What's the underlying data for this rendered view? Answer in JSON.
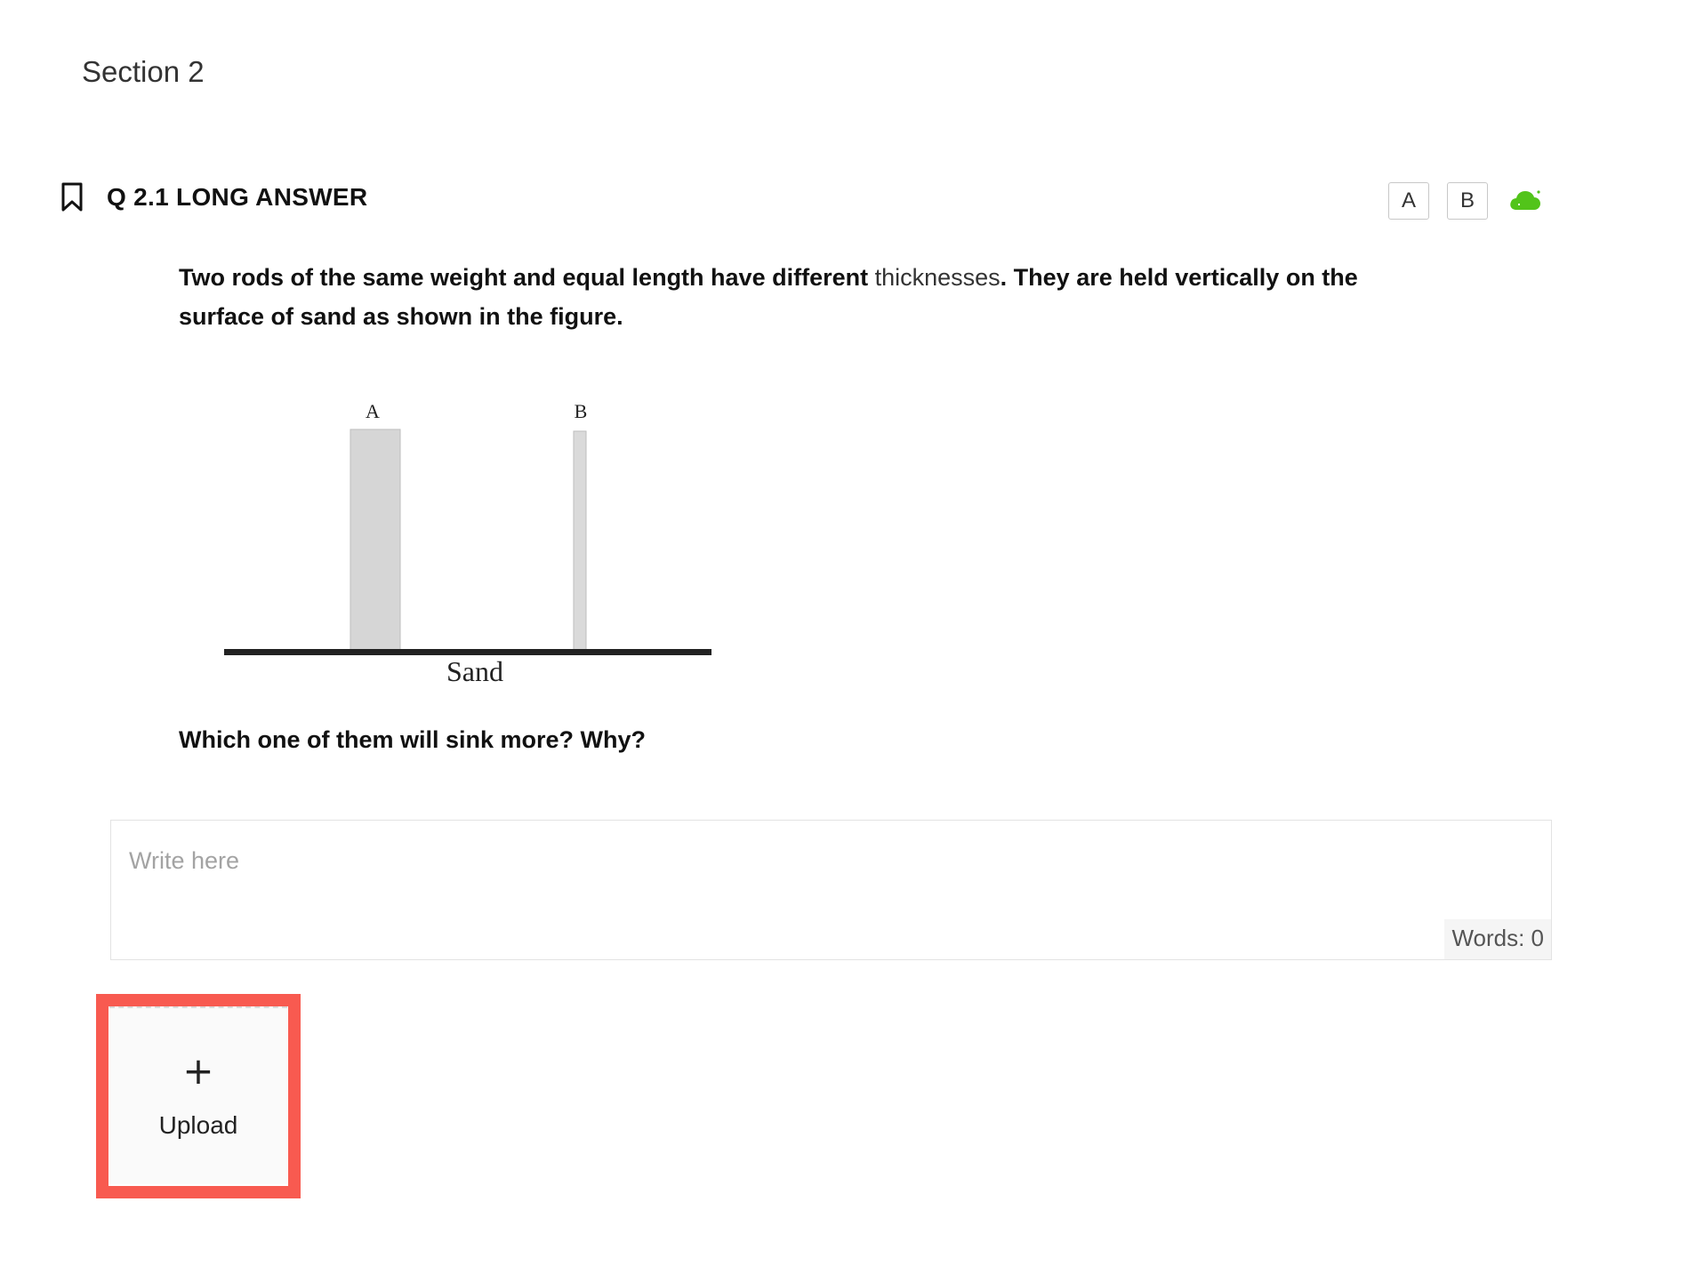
{
  "section": {
    "title": "Section 2"
  },
  "question": {
    "title": "Q 2.1 LONG ANSWER",
    "text_part1": "Two rods of the same weight and equal length have different ",
    "text_highlight": "thicknesses",
    "text_part2": ". They are held vertically on the surface of sand as shown in the figure.",
    "follow_up": "Which one of them will sink more? Why?"
  },
  "toolbar": {
    "font_a_label": "A",
    "font_b_label": "B",
    "save_status_icon": "cloud-saved-icon",
    "accent_color": "#52c41a"
  },
  "figure": {
    "rod_a_label": "A",
    "rod_b_label": "B",
    "ground_label": "Sand"
  },
  "answer": {
    "placeholder": "Write here",
    "value": "",
    "word_count": "Words: 0"
  },
  "upload": {
    "label": "Upload",
    "icon": "plus-icon",
    "highlight_color": "#f85a50"
  }
}
